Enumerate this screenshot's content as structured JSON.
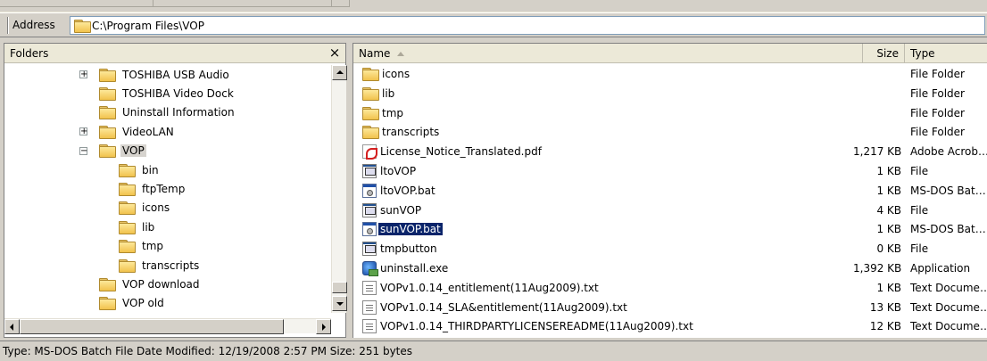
{
  "address": {
    "label": "Address",
    "value": "C:\\Program Files\\VOP"
  },
  "folders": {
    "title": "Folders",
    "close_glyph": "×",
    "tree": [
      {
        "label": "TOSHIBA USB Audio",
        "expander": "+"
      },
      {
        "label": "TOSHIBA Video Dock",
        "expander": ""
      },
      {
        "label": "Uninstall Information",
        "expander": ""
      },
      {
        "label": "VideoLAN",
        "expander": "+"
      },
      {
        "label": "VOP",
        "expander": "−",
        "selected": true
      },
      {
        "label": "bin",
        "expander": ""
      },
      {
        "label": "ftpTemp",
        "expander": ""
      },
      {
        "label": "icons",
        "expander": ""
      },
      {
        "label": "lib",
        "expander": ""
      },
      {
        "label": "tmp",
        "expander": ""
      },
      {
        "label": "transcripts",
        "expander": ""
      },
      {
        "label": "VOP download",
        "expander": ""
      },
      {
        "label": "VOP old",
        "expander": ""
      }
    ]
  },
  "files": {
    "columns": {
      "name": "Name",
      "size": "Size",
      "type": "Type"
    },
    "rows": [
      {
        "name": "icons",
        "size": "",
        "type": "File Folder",
        "icon": "folder-icon"
      },
      {
        "name": "lib",
        "size": "",
        "type": "File Folder",
        "icon": "folder-icon"
      },
      {
        "name": "tmp",
        "size": "",
        "type": "File Folder",
        "icon": "folder-icon"
      },
      {
        "name": "transcripts",
        "size": "",
        "type": "File Folder",
        "icon": "folder-icon"
      },
      {
        "name": "License_Notice_Translated.pdf",
        "size": "1,217 KB",
        "type": "Adobe Acrobat Doc...",
        "icon": "pdf-icon"
      },
      {
        "name": "ltoVOP",
        "size": "1 KB",
        "type": "File",
        "icon": "file-icon"
      },
      {
        "name": "ltoVOP.bat",
        "size": "1 KB",
        "type": "MS-DOS Batch File",
        "icon": "batch-file-icon"
      },
      {
        "name": "sunVOP",
        "size": "4 KB",
        "type": "File",
        "icon": "file-icon"
      },
      {
        "name": "sunVOP.bat",
        "size": "1 KB",
        "type": "MS-DOS Batch File",
        "icon": "batch-file-icon",
        "selected": true
      },
      {
        "name": "tmpbutton",
        "size": "0 KB",
        "type": "File",
        "icon": "file-icon"
      },
      {
        "name": "uninstall.exe",
        "size": "1,392 KB",
        "type": "Application",
        "icon": "installer-icon"
      },
      {
        "name": "VOPv1.0.14_entitlement(11Aug2009).txt",
        "size": "1 KB",
        "type": "Text Document",
        "icon": "text-document-icon"
      },
      {
        "name": "VOPv1.0.14_SLA&entitlement(11Aug2009).txt",
        "size": "13 KB",
        "type": "Text Document",
        "icon": "text-document-icon"
      },
      {
        "name": "VOPv1.0.14_THIRDPARTYLICENSEREADME(11Aug2009).txt",
        "size": "12 KB",
        "type": "Text Document",
        "icon": "text-document-icon"
      }
    ]
  },
  "status": {
    "text": "Type: MS-DOS Batch File Date Modified: 12/19/2008 2:57 PM Size: 251 bytes"
  }
}
